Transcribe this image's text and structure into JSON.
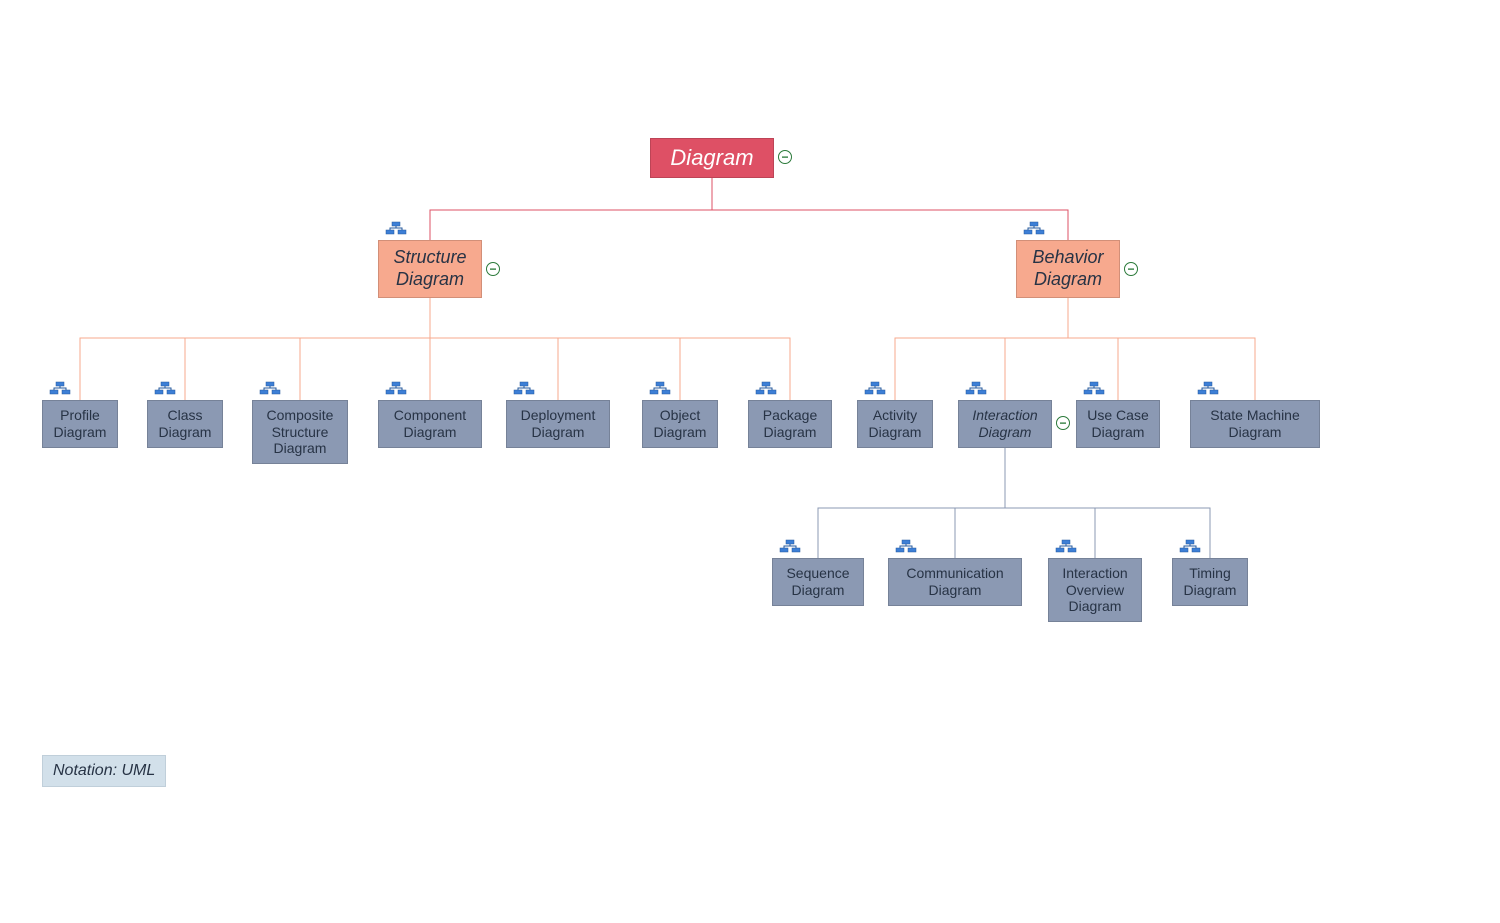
{
  "notation_label": "Notation: UML",
  "collapse_glyph": "−",
  "root": {
    "label": "Diagram"
  },
  "structure": {
    "label": "Structure\nDiagram"
  },
  "behavior": {
    "label": "Behavior\nDiagram"
  },
  "structure_children": {
    "profile": "Profile\nDiagram",
    "class": "Class\nDiagram",
    "composite": "Composite\nStructure\nDiagram",
    "component": "Component\nDiagram",
    "deployment": "Deployment\nDiagram",
    "object": "Object\nDiagram",
    "package": "Package\nDiagram"
  },
  "behavior_children": {
    "activity": "Activity\nDiagram",
    "interaction": "Interaction\nDiagram",
    "usecase": "Use Case\nDiagram",
    "statemachine": "State Machine\nDiagram"
  },
  "interaction_children": {
    "sequence": "Sequence\nDiagram",
    "communication": "Communication\nDiagram",
    "overview": "Interaction\nOverview\nDiagram",
    "timing": "Timing\nDiagram"
  },
  "colors": {
    "root_line": "#de5065",
    "mid_line": "#f7a98e",
    "leaf_line": "#8b99b3"
  }
}
